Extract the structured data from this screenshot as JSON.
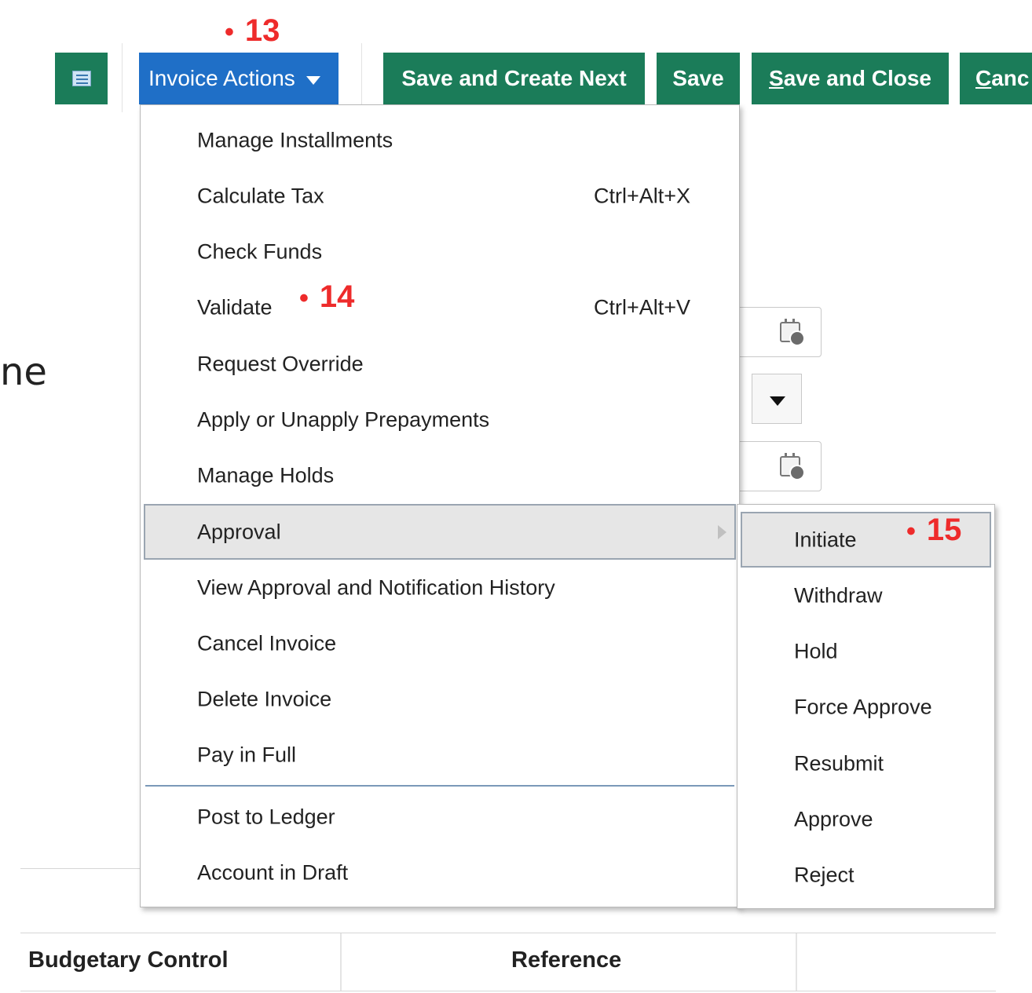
{
  "toolbar": {
    "list_icon": "list-view-icon",
    "invoice_actions_label": "Invoice Actions",
    "save_and_create_next_label": "Save and Create Next",
    "save_label": "Save",
    "save_and_close_label": "Save and Close",
    "cancel_label": "Canc",
    "accent_blue": "#1f6fc7",
    "accent_green": "#1b7c59"
  },
  "markers": {
    "m13": "13",
    "m14": "14",
    "m15": "15",
    "dot": "•",
    "color": "#ee2b2b"
  },
  "menu": {
    "items": [
      {
        "label": "Manage Installments",
        "shortcut": ""
      },
      {
        "label": "Calculate Tax",
        "shortcut": "Ctrl+Alt+X"
      },
      {
        "label": "Check Funds",
        "shortcut": ""
      },
      {
        "label": "Validate",
        "shortcut": "Ctrl+Alt+V"
      },
      {
        "label": "Request Override",
        "shortcut": ""
      },
      {
        "label": "Apply or Unapply Prepayments",
        "shortcut": ""
      },
      {
        "label": "Manage Holds",
        "shortcut": ""
      },
      {
        "label": "Approval",
        "shortcut": ""
      },
      {
        "label": "View Approval and Notification History",
        "shortcut": ""
      },
      {
        "label": "Cancel Invoice",
        "shortcut": ""
      },
      {
        "label": "Delete Invoice",
        "shortcut": ""
      },
      {
        "label": "Pay in Full",
        "shortcut": ""
      },
      {
        "label": "Post to Ledger",
        "shortcut": ""
      },
      {
        "label": "Account in Draft",
        "shortcut": ""
      }
    ]
  },
  "submenu": {
    "items": [
      {
        "label": "Initiate"
      },
      {
        "label": "Withdraw"
      },
      {
        "label": "Hold"
      },
      {
        "label": "Force Approve"
      },
      {
        "label": "Resubmit"
      },
      {
        "label": "Approve"
      },
      {
        "label": "Reject"
      }
    ]
  },
  "background": {
    "partial_label": "ne"
  },
  "table": {
    "headers": [
      "Budgetary Control",
      "Reference"
    ]
  }
}
